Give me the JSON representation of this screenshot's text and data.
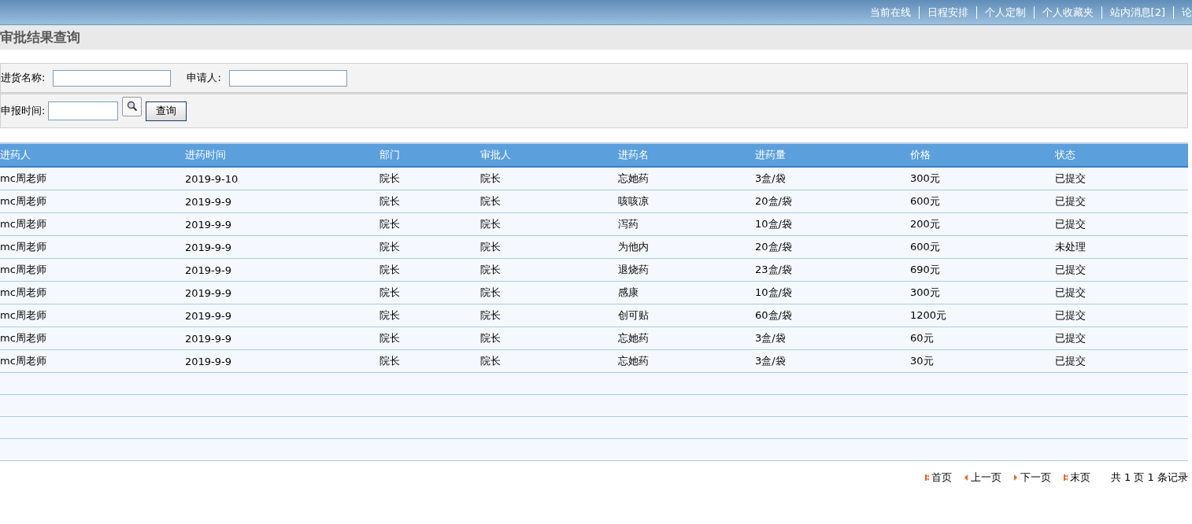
{
  "top_links": [
    "当前在线",
    "日程安排",
    "个人定制",
    "个人收藏夹",
    "站内消息[2]",
    "论"
  ],
  "page_title": "审批结果查询",
  "search": {
    "name_label": "进货名称:",
    "applicant_label": "申请人:",
    "date_label": "申报时间:",
    "query_button": "查询"
  },
  "table": {
    "columns": [
      "进药人",
      "进药时间",
      "部门",
      "审批人",
      "进药名",
      "进药量",
      "价格",
      "状态"
    ],
    "rows": [
      [
        "mc周老师",
        "2019-9-10",
        "院长",
        "院长",
        "忘她药",
        "3盒/袋",
        "300元",
        "已提交"
      ],
      [
        "mc周老师",
        "2019-9-9",
        "院长",
        "院长",
        "咳咳凉",
        "20盒/袋",
        "600元",
        "已提交"
      ],
      [
        "mc周老师",
        "2019-9-9",
        "院长",
        "院长",
        "泻药",
        "10盒/袋",
        "200元",
        "已提交"
      ],
      [
        "mc周老师",
        "2019-9-9",
        "院长",
        "院长",
        "为他内",
        "20盒/袋",
        "600元",
        "未处理"
      ],
      [
        "mc周老师",
        "2019-9-9",
        "院长",
        "院长",
        "退烧药",
        "23盒/袋",
        "690元",
        "已提交"
      ],
      [
        "mc周老师",
        "2019-9-9",
        "院长",
        "院长",
        "感康",
        "10盒/袋",
        "300元",
        "已提交"
      ],
      [
        "mc周老师",
        "2019-9-9",
        "院长",
        "院长",
        "创可贴",
        "60盒/袋",
        "1200元",
        "已提交"
      ],
      [
        "mc周老师",
        "2019-9-9",
        "院长",
        "院长",
        "忘她药",
        "3盒/袋",
        "60元",
        "已提交"
      ],
      [
        "mc周老师",
        "2019-9-9",
        "院长",
        "院长",
        "忘她药",
        "3盒/袋",
        "30元",
        "已提交"
      ]
    ]
  },
  "pager": {
    "links": [
      {
        "kind": "first",
        "label": "首页"
      },
      {
        "kind": "prev",
        "label": "上一页"
      },
      {
        "kind": "next",
        "label": "下一页"
      },
      {
        "kind": "last",
        "label": "末页"
      }
    ],
    "summary": "共 1 页 1 条记录"
  }
}
